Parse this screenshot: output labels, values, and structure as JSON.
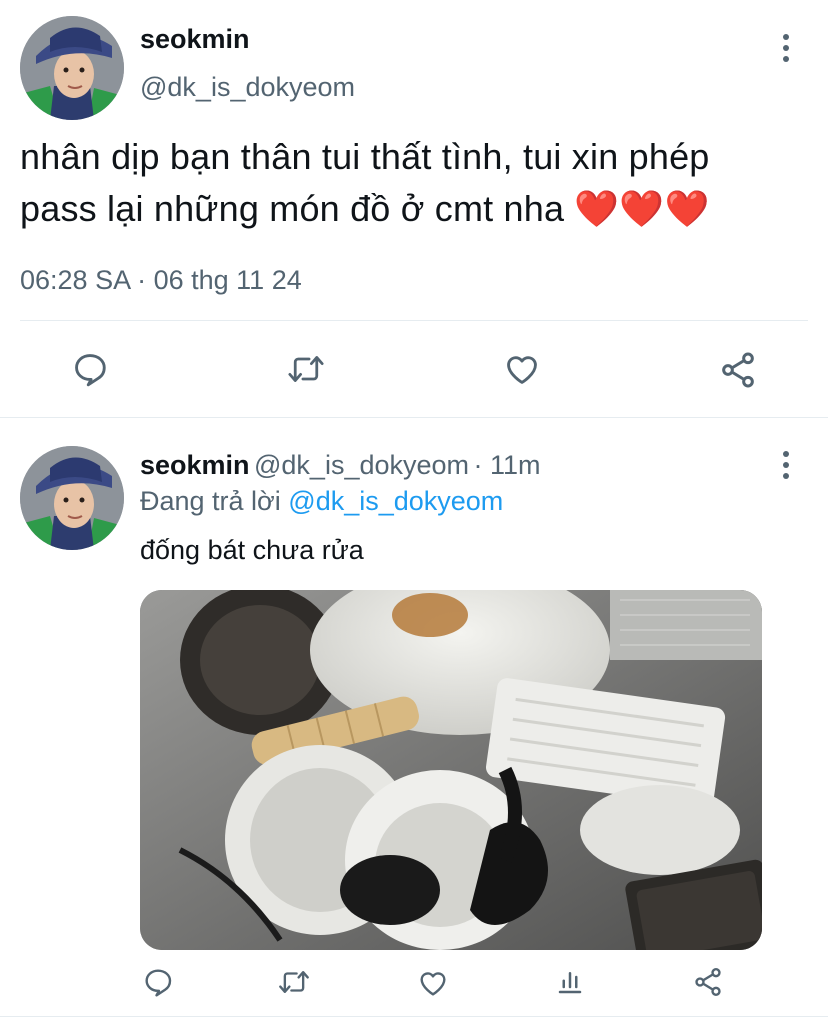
{
  "main_tweet": {
    "display_name": "seokmin",
    "handle": "@dk_is_dokyeom",
    "text_line1": "nhân dịp bạn thân tui thất tình, tui xin phép",
    "text_line2": "pass lại những món đồ ở cmt nha",
    "emoji": "❤️❤️❤️",
    "timestamp": "06:28 SA · 06 thg 11 24"
  },
  "reply_tweet": {
    "display_name": "seokmin",
    "handle": "@dk_is_dokyeom",
    "age": "· 11m",
    "replying_prefix": "Đang trả lời",
    "replying_handle": "@dk_is_dokyeom",
    "text": "đống bát chưa rửa"
  },
  "colors": {
    "text": "#0f1419",
    "secondary": "#536471",
    "link": "#1d9bf0",
    "divider": "#e6ecf0",
    "heart": "#e0245e"
  },
  "icons": {
    "reply": "reply-icon",
    "retweet": "retweet-icon",
    "like": "like-icon",
    "share": "share-icon",
    "views": "views-icon",
    "more": "more-icon"
  }
}
